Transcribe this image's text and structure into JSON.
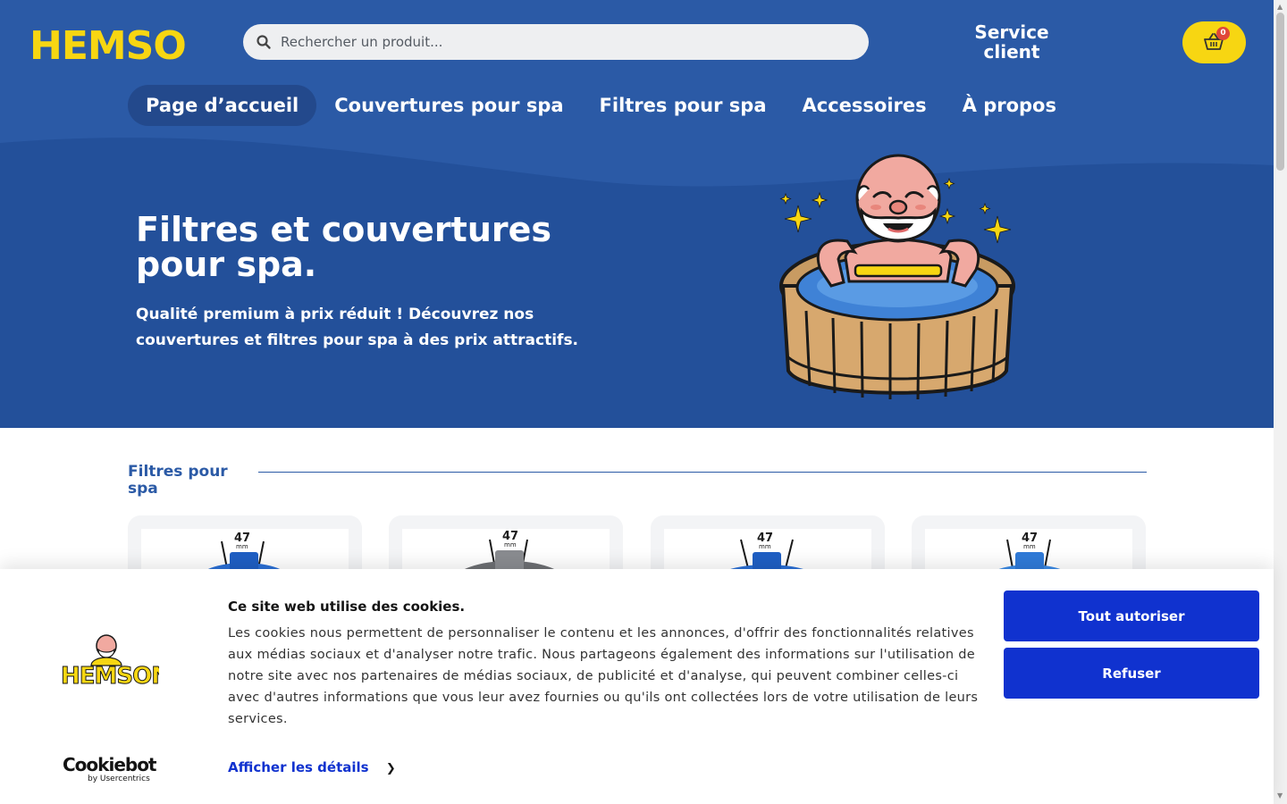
{
  "header": {
    "logo_text": "HEMSON",
    "search": {
      "placeholder": "Rechercher un produit..."
    },
    "service_line1": "Service",
    "service_line2": "client",
    "cart": {
      "count": "0",
      "icon": "basket-icon"
    }
  },
  "nav": {
    "items": [
      {
        "label": "Page d’accueil",
        "active": true
      },
      {
        "label": "Couvertures pour spa",
        "active": false
      },
      {
        "label": "Filtres pour spa",
        "active": false
      },
      {
        "label": "Accessoires",
        "active": false
      },
      {
        "label": "À propos",
        "active": false
      }
    ]
  },
  "hero": {
    "title": "Filtres et couvertures pour spa.",
    "subtitle": "Qualité premium à prix réduit ! Découvrez nos couvertures et filtres pour spa à des prix attractifs."
  },
  "section": {
    "title": "Filtres pour spa",
    "products": [
      {
        "dimension": "47",
        "unit": "mm",
        "color": "#2a6fd6"
      },
      {
        "dimension": "47",
        "unit": "mm",
        "color": "#6d6f73"
      },
      {
        "dimension": "47",
        "unit": "mm",
        "color": "#2a6fd6"
      },
      {
        "dimension": "47",
        "unit": "mm",
        "color": "#3a8ae6"
      }
    ]
  },
  "cookie": {
    "title": "Ce site web utilise des cookies.",
    "text": "Les cookies nous permettent de personnaliser le contenu et les annonces, d'offrir des fonctionnalités relatives aux médias sociaux et d'analyser notre trafic. Nous partageons également des informations sur l'utilisation de notre site avec nos partenaires de médias sociaux, de publicité et d'analyse, qui peuvent combiner celles-ci avec d'autres informations que vous leur avez fournies ou qu'ils ont collectées lors de votre utilisation de leurs services.",
    "details_label": "Afficher les détails",
    "allow_label": "Tout autoriser",
    "refuse_label": "Refuser",
    "brand_name": "Cookiebot",
    "brand_by": "by Usercentrics",
    "logo_text": "HEMSON"
  },
  "colors": {
    "brand_blue": "#2b5aa6",
    "nav_active": "#23498c",
    "brand_yellow": "#f7d612",
    "cookie_button": "#1032cf"
  }
}
